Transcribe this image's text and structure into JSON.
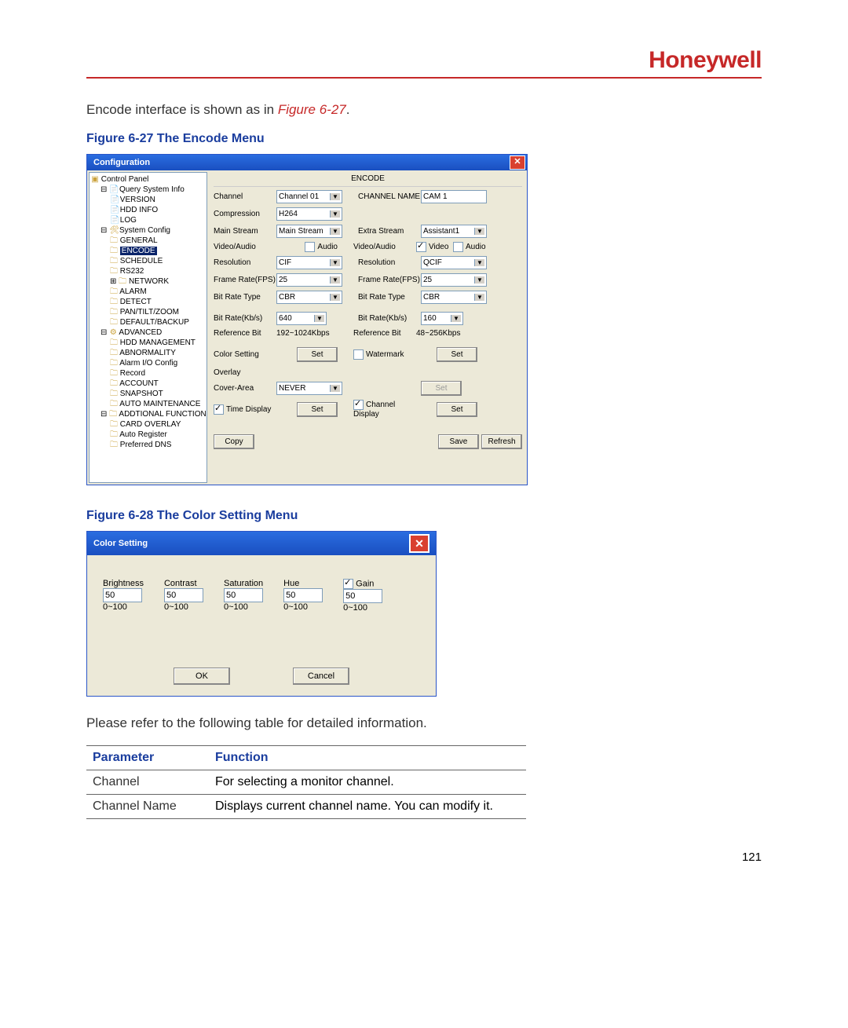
{
  "brand": "Honeywell",
  "intro_pre": "Encode interface is shown as in ",
  "intro_ref": "Figure 6-27",
  "intro_post": ".",
  "fig27_caption": "Figure 6-27 The Encode Menu",
  "fig28_caption": "Figure 6-28 The Color Setting Menu",
  "outro": "Please refer to the following table for detailed information.",
  "page_number": "121",
  "config_window": {
    "title": "Configuration",
    "panel_title": "ENCODE",
    "tree": {
      "root": "Control Panel",
      "query": "Query System Info",
      "version": "VERSION",
      "hdd": "HDD INFO",
      "log": "LOG",
      "sysconf": "System Config",
      "general": "GENERAL",
      "encode": "ENCODE",
      "schedule": "SCHEDULE",
      "rs232": "RS232",
      "network": "NETWORK",
      "alarm": "ALARM",
      "detect": "DETECT",
      "ptz": "PAN/TILT/ZOOM",
      "default": "DEFAULT/BACKUP",
      "advanced": "ADVANCED",
      "hddmgmt": "HDD MANAGEMENT",
      "abnorm": "ABNORMALITY",
      "alarmio": "Alarm I/O Config",
      "record": "Record",
      "account": "ACCOUNT",
      "snapshot": "SNAPSHOT",
      "automaint": "AUTO MAINTENANCE",
      "addfunc": "ADDTIONAL FUNCTION",
      "cardov": "CARD OVERLAY",
      "autoreg": "Auto Register",
      "prefdns": "Preferred DNS"
    },
    "labels": {
      "channel": "Channel",
      "channel_name": "CHANNEL NAME",
      "compression": "Compression",
      "main_stream": "Main Stream",
      "extra_stream": "Extra Stream",
      "video_audio": "Video/Audio",
      "audio": "Audio",
      "video": "Video",
      "resolution": "Resolution",
      "framerate": "Frame Rate(FPS)",
      "bitratetype": "Bit Rate Type",
      "bitrate": "Bit Rate(Kb/s)",
      "refbit": "Reference Bit",
      "colorsetting": "Color Setting",
      "watermark": "Watermark",
      "overlay": "Overlay",
      "coverarea": "Cover-Area",
      "timedisplay": "Time Display",
      "chdisplay": "Channel Display",
      "set": "Set",
      "copy": "Copy",
      "save": "Save",
      "refresh": "Refresh"
    },
    "values": {
      "channel": "Channel 01",
      "channel_name": "CAM 1",
      "compression": "H264",
      "main_stream": "Main Stream",
      "extra_stream": "Assistant1",
      "resolution_main": "CIF",
      "resolution_extra": "QCIF",
      "fps_main": "25",
      "fps_extra": "25",
      "brtype_main": "CBR",
      "brtype_extra": "CBR",
      "br_main": "640",
      "br_extra": "160",
      "refbit_main": "192~1024Kbps",
      "refbit_extra": "48~256Kbps",
      "coverarea": "NEVER"
    }
  },
  "color_window": {
    "title": "Color Setting",
    "cols": {
      "brightness": "Brightness",
      "contrast": "Contrast",
      "saturation": "Saturation",
      "hue": "Hue",
      "gain": "Gain"
    },
    "vals": {
      "brightness": "50",
      "contrast": "50",
      "saturation": "50",
      "hue": "50",
      "gain": "50"
    },
    "range": "0~100",
    "ok": "OK",
    "cancel": "Cancel"
  },
  "table": {
    "h1": "Parameter",
    "h2": "Function",
    "rows": [
      {
        "p": "Channel",
        "f": "For selecting a monitor channel."
      },
      {
        "p": "Channel Name",
        "f": "Displays current channel name. You can modify it."
      }
    ]
  }
}
